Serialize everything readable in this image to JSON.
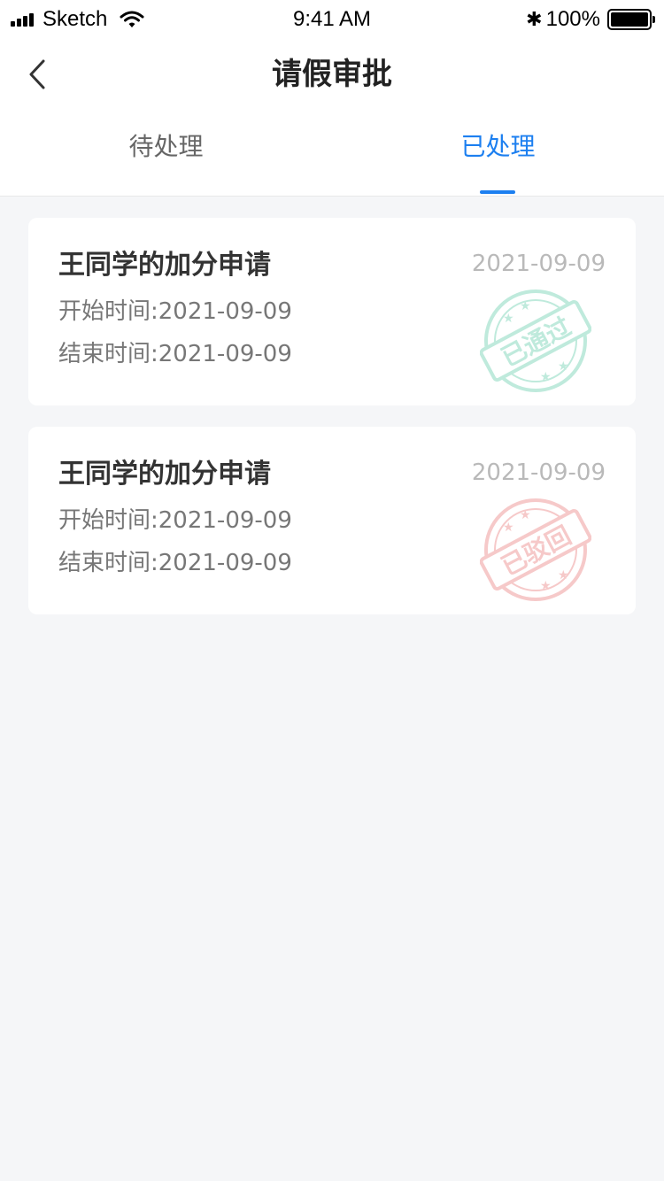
{
  "status_bar": {
    "carrier": "Sketch",
    "time": "9:41 AM",
    "bluetooth": "✱",
    "battery_percent": "100%",
    "battery_level": 1.0
  },
  "nav": {
    "back_icon": "chevron-left-icon",
    "title": "请假审批"
  },
  "tabs": [
    {
      "label": "待处理",
      "active": false
    },
    {
      "label": "已处理",
      "active": true
    }
  ],
  "colors": {
    "accent": "#1c7ff0",
    "approved_stamp": "#bfeadc",
    "rejected_stamp": "#f6c9c9"
  },
  "cards": [
    {
      "title": "王同学的加分申请",
      "date": "2021-09-09",
      "start_label": "开始时间:",
      "start_value": "2021-09-09",
      "end_label": "结束时间:",
      "end_value": "2021-09-09",
      "stamp": "已通过"
    },
    {
      "title": "王同学的加分申请",
      "date": "2021-09-09",
      "start_label": "开始时间:",
      "start_value": "2021-09-09",
      "end_label": "结束时间:",
      "end_value": "2021-09-09",
      "stamp": "已驳回"
    }
  ]
}
